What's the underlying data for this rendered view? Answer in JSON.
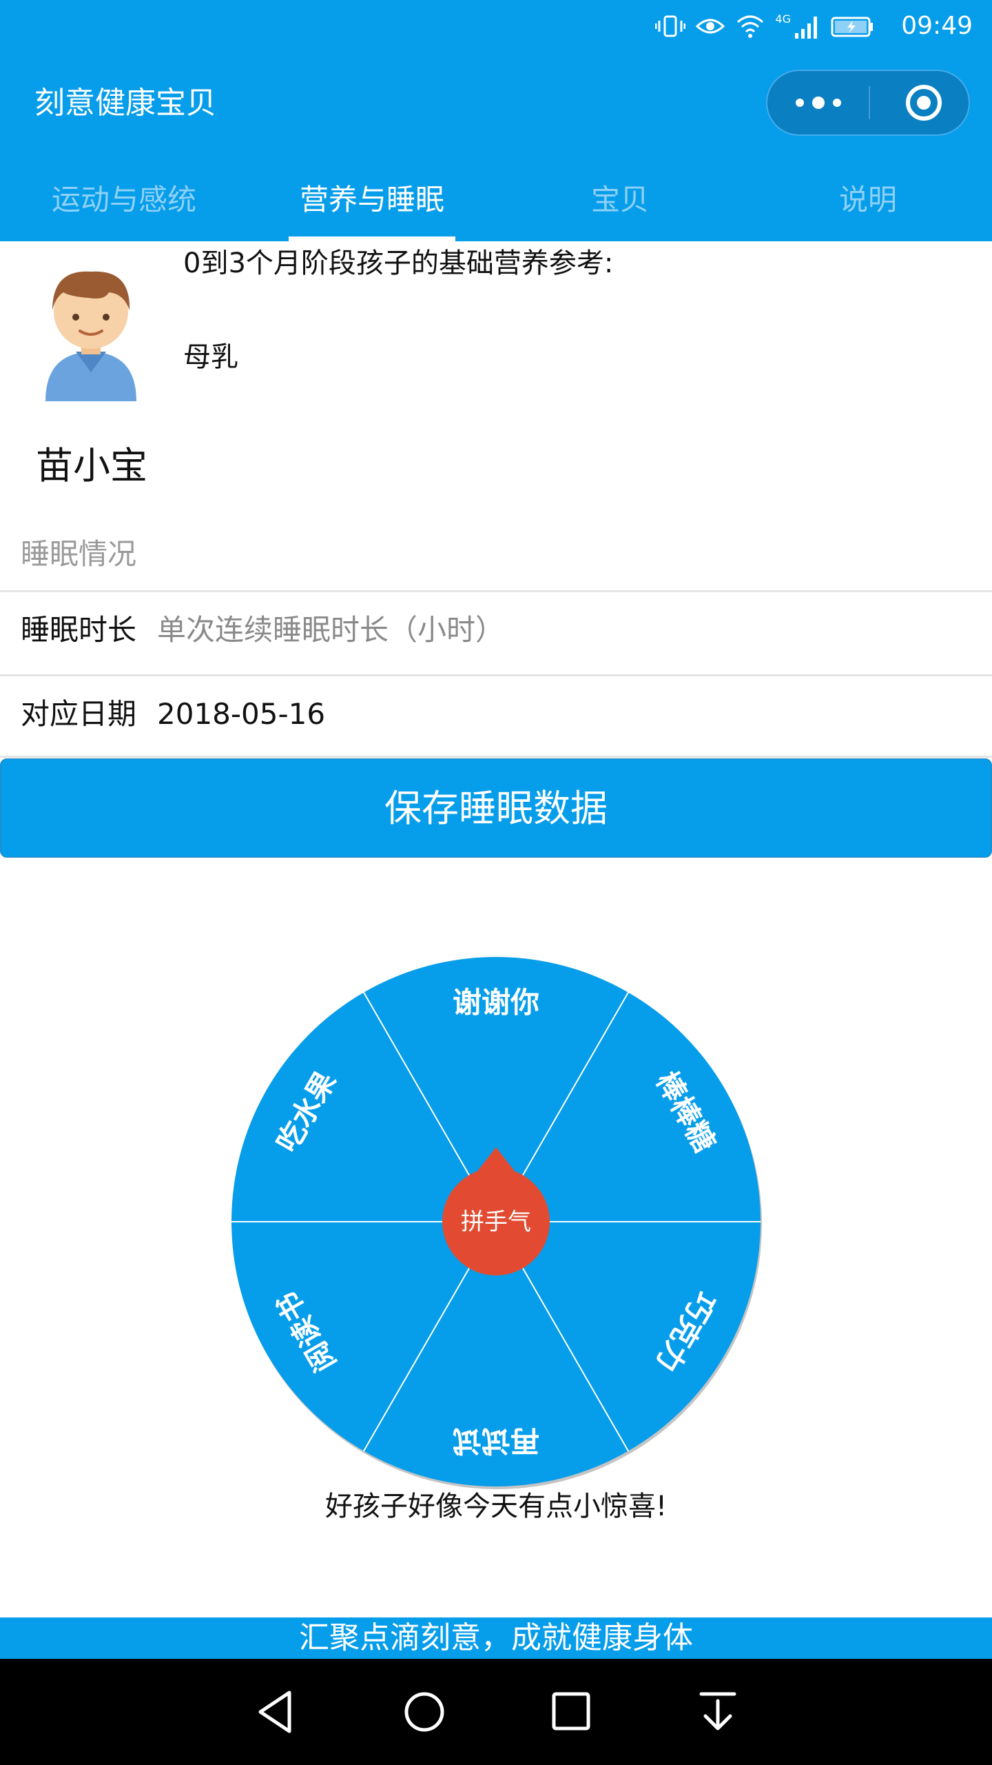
{
  "status_bar": {
    "time": "09:49",
    "network": "4G",
    "icons": [
      "vibrate-icon",
      "eye-icon",
      "wifi-icon",
      "signal-icon",
      "battery-icon"
    ]
  },
  "header": {
    "title": "刻意健康宝贝",
    "menu_icon": "more-dots-icon",
    "close_icon": "target-icon"
  },
  "tabs": [
    {
      "label": "运动与感统",
      "active": false
    },
    {
      "label": "营养与睡眠",
      "active": true
    },
    {
      "label": "宝贝",
      "active": false
    },
    {
      "label": "说明",
      "active": false
    }
  ],
  "baby": {
    "name": "苗小宝",
    "avatar_icon": "boy-avatar-icon"
  },
  "nutrition": {
    "title": "0到3个月阶段孩子的基础营养参考:",
    "items": [
      "母乳"
    ]
  },
  "sleep_form": {
    "section_label": "睡眠情况",
    "duration_label": "睡眠时长",
    "duration_placeholder": "单次连续睡眠时长（小时）",
    "duration_value": "",
    "date_label": "对应日期",
    "date_value": "2018-05-16",
    "save_button": "保存睡眠数据"
  },
  "wheel": {
    "segments": [
      "谢谢你",
      "棒棒糖",
      "巧克力",
      "再试试",
      "阅读书",
      "吃水果"
    ],
    "center_label": "拼手气",
    "caption": "好孩子好像今天有点小惊喜!",
    "colors": {
      "wheel": "#069dea",
      "pointer": "#e24b31",
      "divider": "#ffffff"
    }
  },
  "footer": {
    "slogan": "汇聚点滴刻意，成就健康身体"
  },
  "nav_bar": {
    "buttons": [
      "back-icon",
      "home-icon",
      "recents-icon",
      "notification-pull-icon"
    ]
  },
  "colors": {
    "primary": "#069dea",
    "tab_inactive": "#8fd1f6",
    "capsule": "#0a7fc2"
  }
}
